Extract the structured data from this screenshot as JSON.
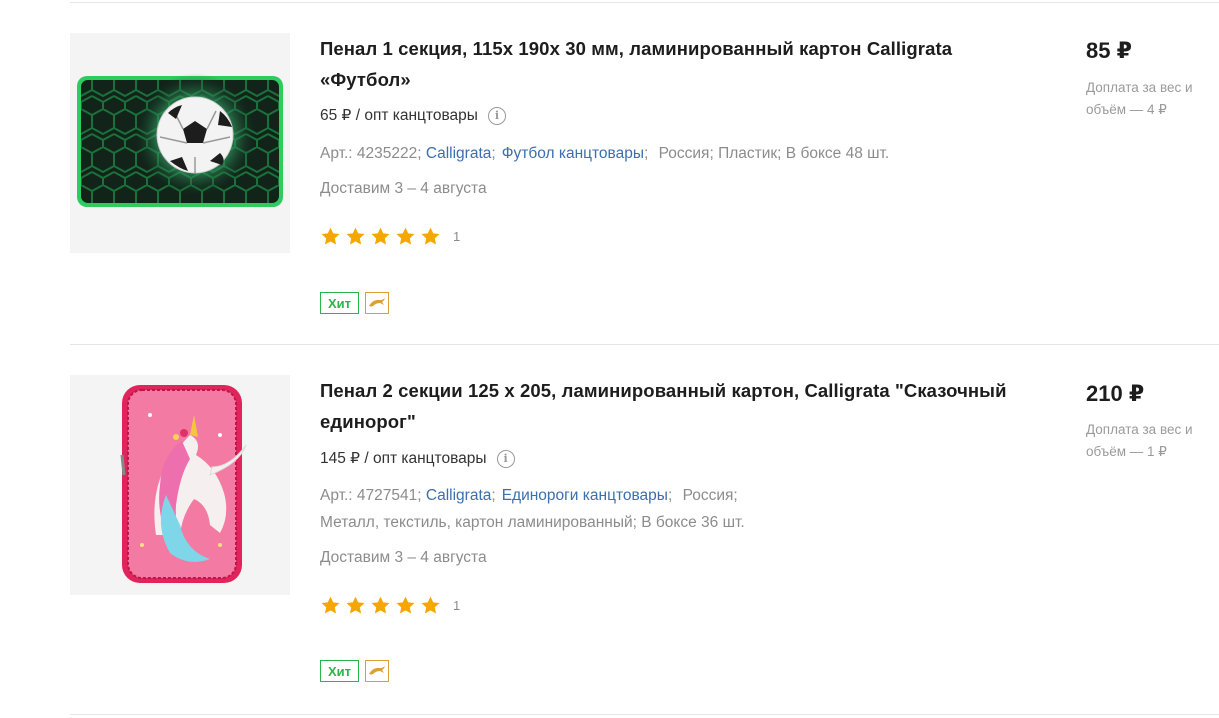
{
  "products": [
    {
      "title": "Пенал 1 секция, 115х 190х 30 мм, ламинированный картон Calligrata «Футбол»",
      "wholesale": "65 ₽ / опт канцтовары",
      "article": "Арт.: 4235222;",
      "brand": "Calligrata",
      "category": "Футбол канцтовары",
      "country": "Россия;",
      "material": "Пластик;",
      "box": "В боксе 48 шт.",
      "delivery": "Доставим 3 – 4 августа",
      "rating": 5,
      "rating_count": "1",
      "badge_hit": "Хит",
      "price": "85 ₽",
      "surcharge": "Доплата за вес и объём — 4 ₽"
    },
    {
      "title": "Пенал 2 секции 125 х 205, ламинированный картон, Calligrata \"Сказочный единорог\"",
      "wholesale": "145 ₽ / опт канцтовары",
      "article": "Арт.: 4727541;",
      "brand": "Calligrata",
      "category": "Единороги канцтовары",
      "country": "Россия;",
      "material": "Металл, текстиль, картон ламинированный;",
      "box": "В боксе 36 шт.",
      "delivery": "Доставим 3 – 4 августа",
      "rating": 5,
      "rating_count": "1",
      "badge_hit": "Хит",
      "price": "210 ₽",
      "surcharge": "Доплата за вес и объём — 1 ₽"
    }
  ],
  "colors": {
    "link": "#3a6fb0",
    "hit_badge": "#2db34a",
    "star": "#f5a700",
    "dolphin_badge": "#d9a13a"
  }
}
